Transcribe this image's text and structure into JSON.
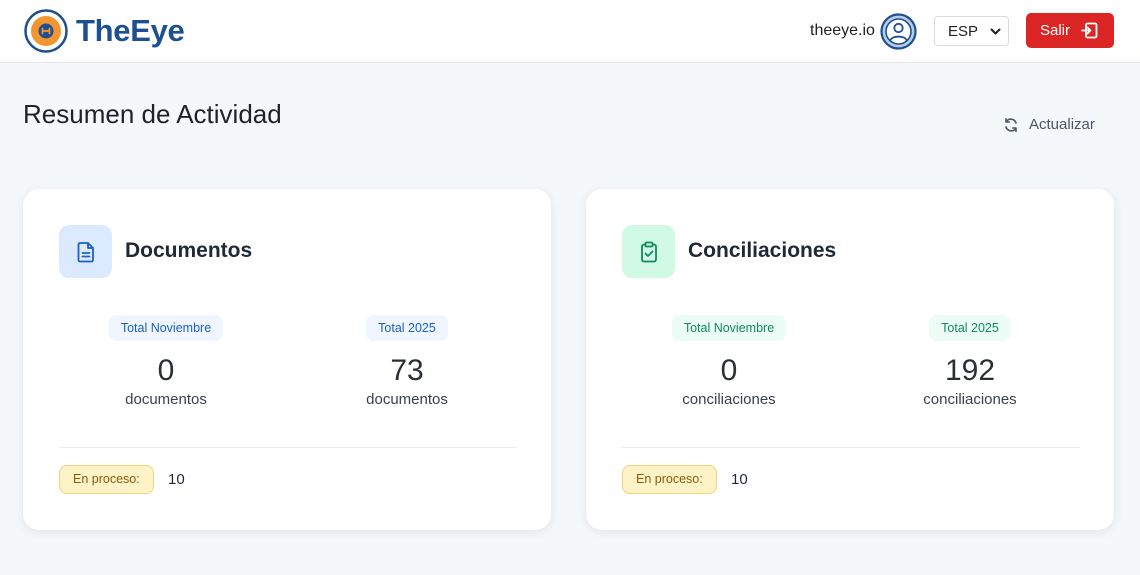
{
  "header": {
    "brand": "TheEye",
    "user": "theeye.io",
    "language": "ESP",
    "logout_label": "Salir"
  },
  "page": {
    "title": "Resumen de Actividad",
    "refresh_label": "Actualizar"
  },
  "cards": [
    {
      "title": "Documentos",
      "icon": "document-icon",
      "accent": "#1d5fc6",
      "stats": [
        {
          "label": "Total Noviembre",
          "value": "0",
          "unit": "documentos"
        },
        {
          "label": "Total 2025",
          "value": "73",
          "unit": "documentos"
        }
      ],
      "process_label": "En proceso:",
      "process_value": "10"
    },
    {
      "title": "Conciliaciones",
      "icon": "clipboard-check-icon",
      "accent": "#0f8a5f",
      "stats": [
        {
          "label": "Total Noviembre",
          "value": "0",
          "unit": "conciliaciones"
        },
        {
          "label": "Total 2025",
          "value": "192",
          "unit": "conciliaciones"
        }
      ],
      "process_label": "En proceso:",
      "process_value": "10"
    }
  ],
  "colors": {
    "brand": "#1e4f91",
    "logout": "#dc2626",
    "pending": "#fef3c7"
  }
}
